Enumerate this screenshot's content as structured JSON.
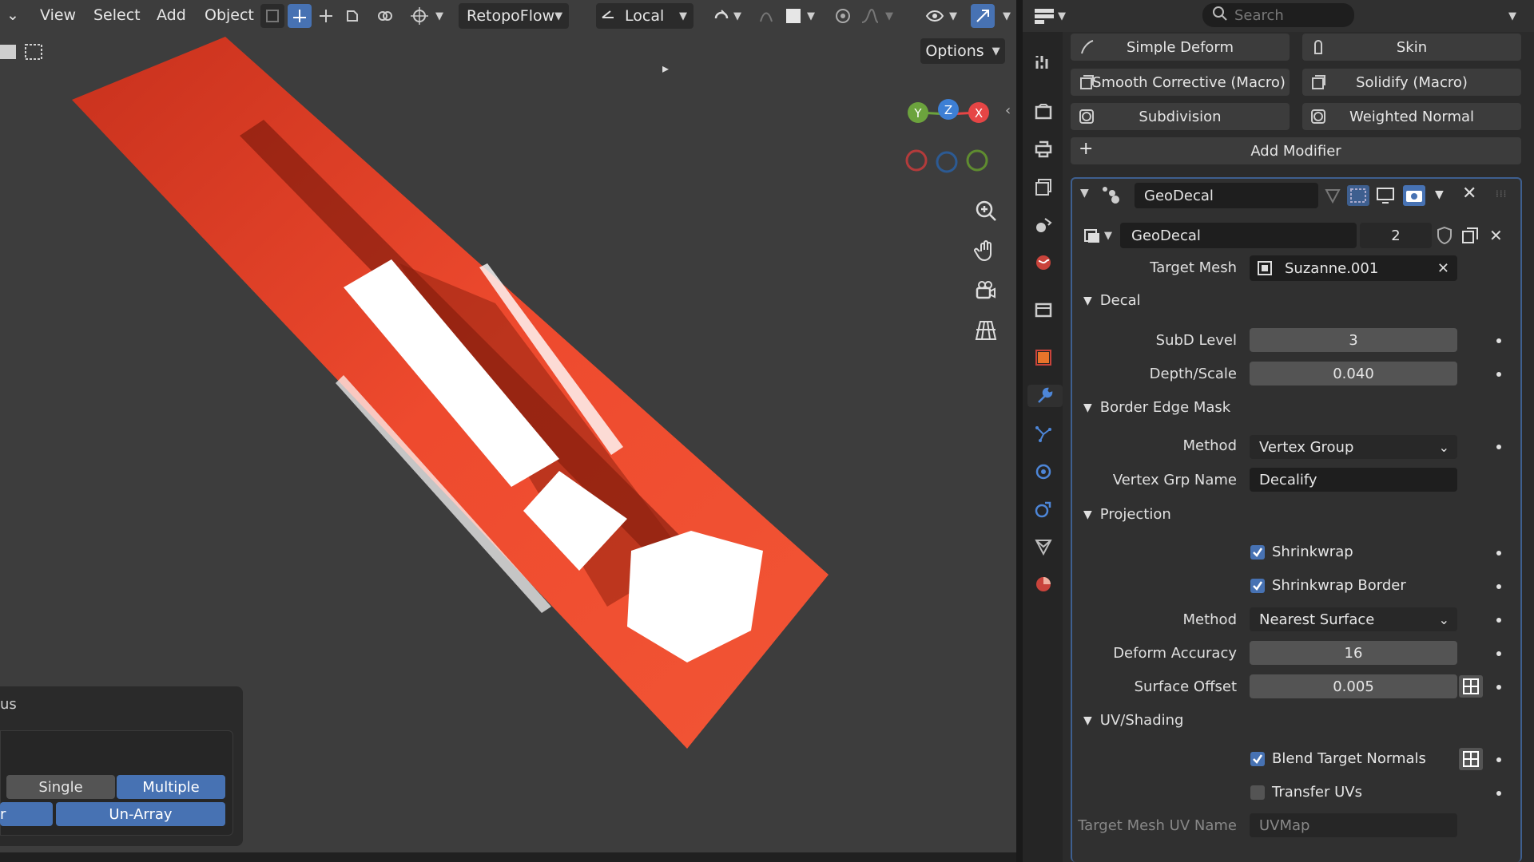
{
  "viewport": {
    "menu": {
      "view": "View",
      "select": "Select",
      "add": "Add",
      "object": "Object"
    },
    "retopoflow": "RetopoFlow",
    "transform_orientation": "Local",
    "options": "Options"
  },
  "operator_panel": {
    "title_fragment": "us",
    "mode_single": "Single",
    "mode_multiple": "Multiple",
    "left_fragment": "r",
    "un_array": "Un-Array"
  },
  "properties": {
    "search_placeholder": "Search",
    "modifier_buttons": {
      "simple_deform": "Simple Deform",
      "skin": "Skin",
      "smooth_corrective": "Smooth Corrective (Macro)",
      "solidify": "Solidify (Macro)",
      "subdivision": "Subdivision",
      "weighted_normal": "Weighted Normal",
      "add_modifier": "Add Modifier"
    },
    "modifier": {
      "name": "GeoDecal",
      "node_group": "GeoDecal",
      "users": "2",
      "target_mesh_label": "Target Mesh",
      "target_mesh_value": "Suzanne.001",
      "decal_section": "Decal",
      "subd_label": "SubD Level",
      "subd_value": "3",
      "depth_label": "Depth/Scale",
      "depth_value": "0.040",
      "border_section": "Border Edge Mask",
      "method_label": "Method",
      "method_value": "Vertex Group",
      "vgrp_label": "Vertex Grp Name",
      "vgrp_value": "Decalify",
      "projection_section": "Projection",
      "shrinkwrap": "Shrinkwrap",
      "shrinkwrap_border": "Shrinkwrap Border",
      "proj_method_label": "Method",
      "proj_method_value": "Nearest Surface",
      "deform_acc_label": "Deform Accuracy",
      "deform_acc_value": "16",
      "surface_offset_label": "Surface Offset",
      "surface_offset_value": "0.005",
      "uv_section": "UV/Shading",
      "blend_normals": "Blend Target Normals",
      "transfer_uvs": "Transfer UVs",
      "uv_name_label": "Target Mesh UV Name",
      "uv_name_value": "UVMap"
    }
  },
  "colors": {
    "accent": "#4772b3",
    "decal": "#e8412a",
    "axis_x": "#e64545",
    "axis_y": "#6ca33d",
    "axis_z": "#3d7fd4"
  }
}
